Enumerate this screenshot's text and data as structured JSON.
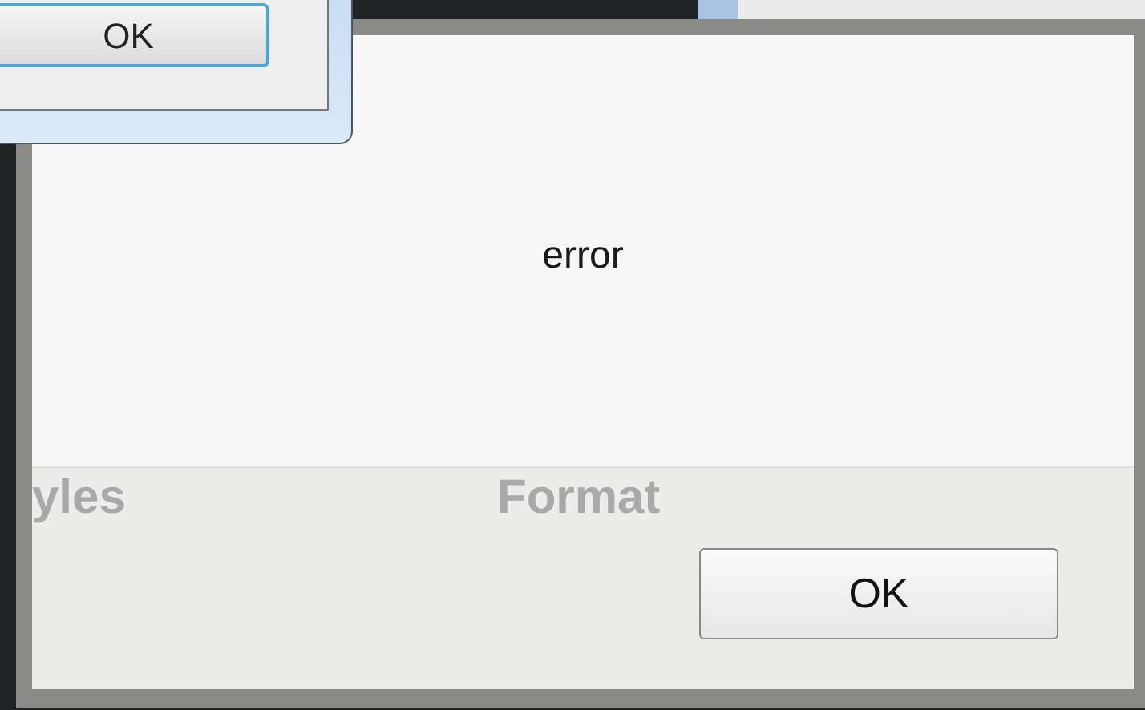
{
  "back_dialog": {
    "button": "OK"
  },
  "dialog": {
    "message": "error",
    "ghost_labels": [
      "yles",
      "Format"
    ],
    "button": "OK"
  }
}
